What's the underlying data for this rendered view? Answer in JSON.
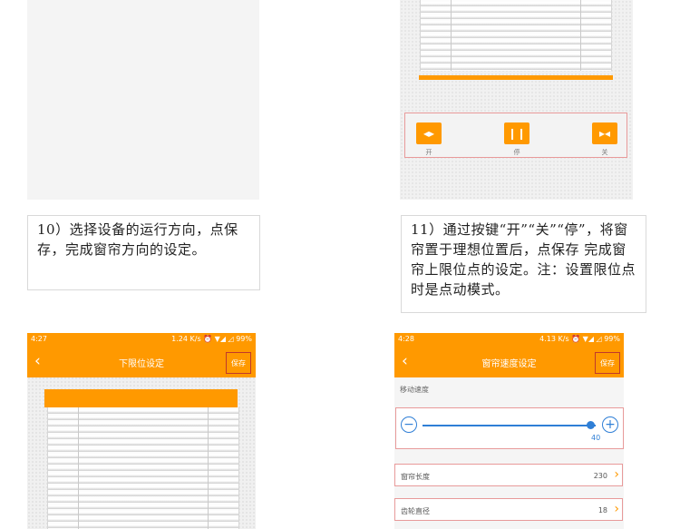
{
  "step10": {
    "caption": "10）选择设备的运行方向，点保存，完成窗帘方向的设定。"
  },
  "step11": {
    "caption": "11）通过按键“开”“关”“停”，将窗帘置于理想位置后，点保存 完成窗帘上限位点的设定。注：设置限位点时是点动模式。",
    "controls": [
      {
        "label": "开",
        "icon": "open-icon"
      },
      {
        "label": "停",
        "icon": "pause-icon"
      },
      {
        "label": "关",
        "icon": "close-icon"
      }
    ]
  },
  "phone_lower_limit": {
    "status_time": "4:27",
    "status_right": "1.24 K/s ⏰ ▼◢ ◿ 99%",
    "title": "下限位设定",
    "save_label": "保存"
  },
  "phone_speed": {
    "status_time": "4:28",
    "status_right": "4.13 K/s ⏰ ▼◢ ◿ 99%",
    "title": "窗帘速度设定",
    "save_label": "保存",
    "section_label": "移动速度",
    "slider": {
      "value": "40",
      "fill_fraction": 0.97
    },
    "rows": [
      {
        "label": "窗帘长度",
        "value": "230"
      },
      {
        "label": "齿轮直径",
        "value": "18"
      }
    ]
  },
  "colors": {
    "accent": "#ff9900",
    "slider": "#2f7fd6",
    "highlight_border": "#e89a9a"
  }
}
